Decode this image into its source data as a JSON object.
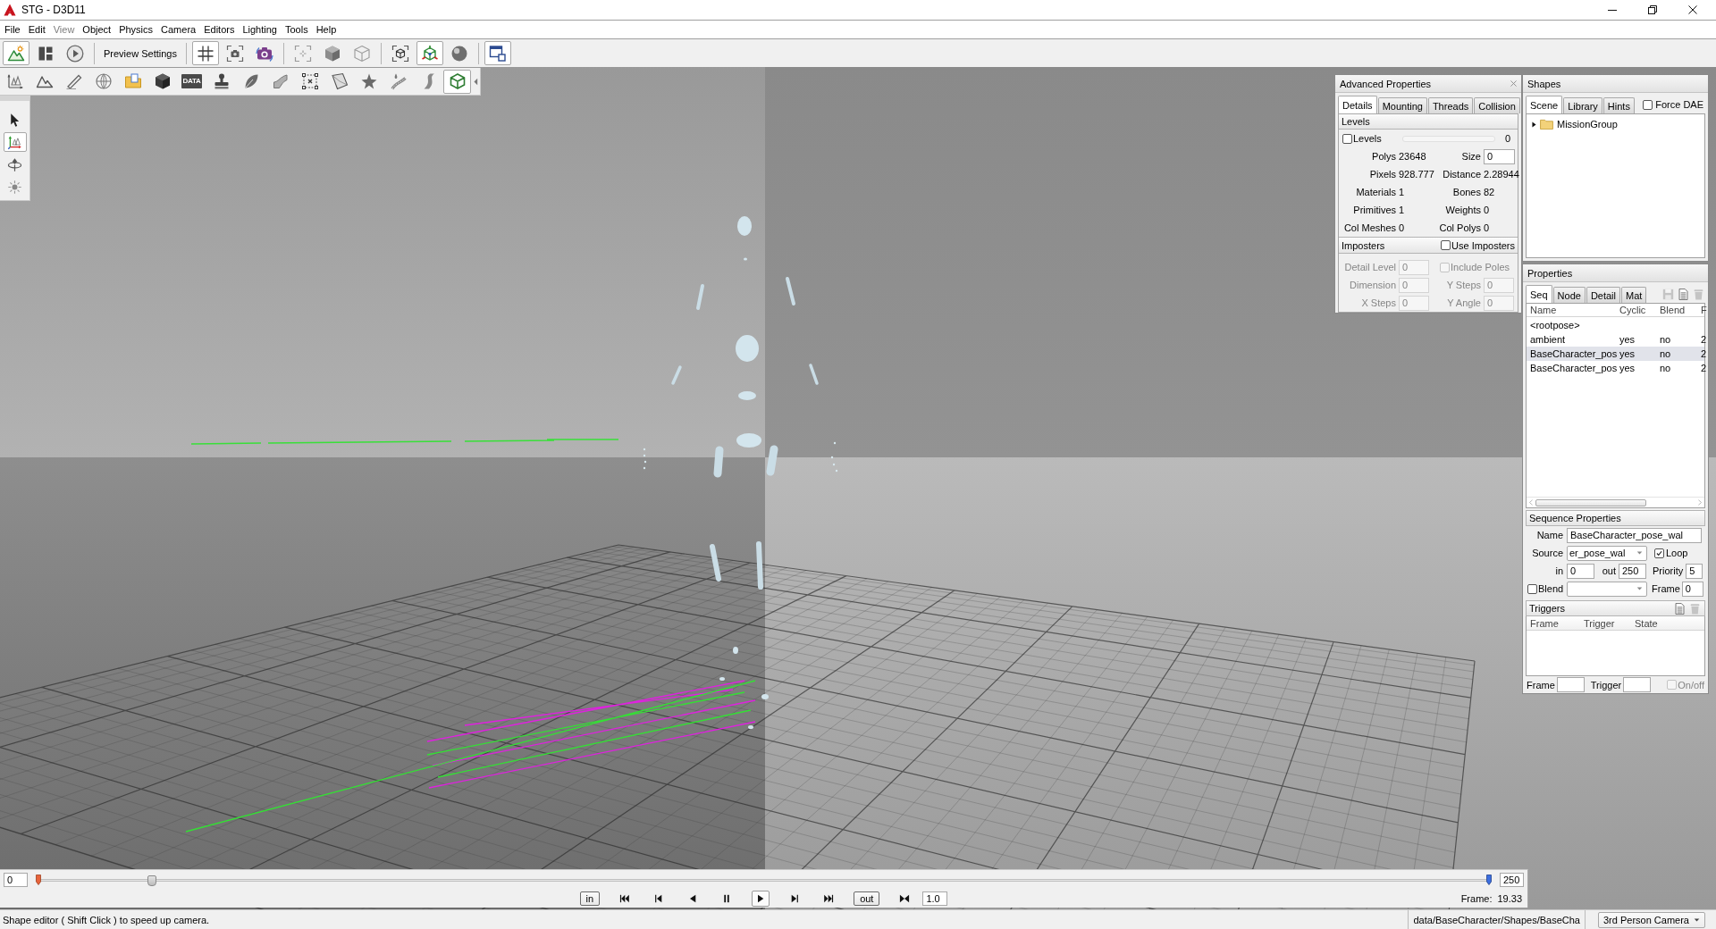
{
  "window": {
    "title": "STG - D3D11"
  },
  "menu": [
    {
      "label": "File",
      "disabled": false
    },
    {
      "label": "Edit",
      "disabled": false
    },
    {
      "label": "View",
      "disabled": true
    },
    {
      "label": "Object",
      "disabled": false
    },
    {
      "label": "Physics",
      "disabled": false
    },
    {
      "label": "Camera",
      "disabled": false
    },
    {
      "label": "Editors",
      "disabled": false
    },
    {
      "label": "Lighting",
      "disabled": false
    },
    {
      "label": "Tools",
      "disabled": false
    },
    {
      "label": "Help",
      "disabled": false
    }
  ],
  "toolbar": {
    "groups": [
      {
        "buttons": [
          {
            "kind": "icon",
            "selected": true
          },
          {
            "kind": "icon",
            "selected": false
          },
          {
            "kind": "icon",
            "selected": false
          }
        ]
      },
      {
        "buttons": [
          {
            "kind": "text",
            "label": "Preview Settings",
            "selected": false
          }
        ]
      },
      {
        "buttons": [
          {
            "kind": "icon",
            "selected": true
          },
          {
            "kind": "icon",
            "selected": false
          },
          {
            "kind": "icon",
            "selected": false
          }
        ]
      },
      {
        "buttons": [
          {
            "kind": "icon",
            "selected": false
          },
          {
            "kind": "icon",
            "selected": false
          },
          {
            "kind": "icon",
            "selected": false
          }
        ]
      },
      {
        "buttons": [
          {
            "kind": "icon",
            "selected": false
          },
          {
            "kind": "icon",
            "selected": true
          },
          {
            "kind": "icon",
            "selected": false
          }
        ]
      },
      {
        "buttons": [
          {
            "kind": "icon",
            "selected": true
          }
        ]
      }
    ]
  },
  "object_toolbar": {
    "buttons": [
      {
        "kind": "icon",
        "selected": false
      },
      {
        "kind": "icon",
        "selected": false
      },
      {
        "kind": "icon",
        "selected": false
      },
      {
        "kind": "icon",
        "selected": false
      },
      {
        "kind": "icon",
        "selected": false
      },
      {
        "kind": "icon",
        "selected": false
      },
      {
        "kind": "tile",
        "label": "DATA",
        "selected": false
      },
      {
        "kind": "icon",
        "selected": false
      },
      {
        "kind": "icon",
        "selected": false
      },
      {
        "kind": "icon",
        "selected": false
      },
      {
        "kind": "icon",
        "selected": false
      },
      {
        "kind": "icon",
        "selected": false
      },
      {
        "kind": "icon",
        "selected": false
      },
      {
        "kind": "icon",
        "selected": false
      },
      {
        "kind": "icon",
        "selected": false
      },
      {
        "kind": "icon",
        "selected": true
      }
    ]
  },
  "tool_palette": [
    {
      "selected": false
    },
    {
      "selected": true
    },
    {
      "selected": false
    },
    {
      "selected": false
    }
  ],
  "advanced_properties": {
    "title": "Advanced Properties",
    "tabs": [
      {
        "label": "Details",
        "selected": true
      },
      {
        "label": "Mounting",
        "selected": false
      },
      {
        "label": "Threads",
        "selected": false
      },
      {
        "label": "Collision",
        "selected": false
      }
    ],
    "levels": {
      "header": "Levels",
      "label": "Levels",
      "checked": false,
      "reading": "0"
    },
    "stats": [
      {
        "label": "Polys",
        "value": "23648",
        "kind": "text"
      },
      {
        "label": "Size",
        "value": "0",
        "kind": "field"
      },
      {
        "label": "Pixels",
        "value": "928.777",
        "kind": "text"
      },
      {
        "label": "Distance",
        "value": "2.28944",
        "kind": "text"
      },
      {
        "label": "Materials",
        "value": "1",
        "kind": "text"
      },
      {
        "label": "Bones",
        "value": "82",
        "kind": "text"
      },
      {
        "label": "Primitives",
        "value": "1",
        "kind": "text"
      },
      {
        "label": "Weights",
        "value": "0",
        "kind": "text"
      },
      {
        "label": "Col Meshes",
        "value": "0",
        "kind": "text"
      },
      {
        "label": "Col Polys",
        "value": "0",
        "kind": "text"
      }
    ],
    "imposters": {
      "header": "Imposters",
      "use_label": "Use Imposters",
      "use_checked": false,
      "disabled": true,
      "fields": [
        {
          "kind": "field",
          "label": "Detail Level",
          "value": "0"
        },
        {
          "kind": "checkbox",
          "label": "Include Poles",
          "checked": false
        },
        {
          "kind": "field",
          "label": "Dimension",
          "value": "0"
        },
        {
          "kind": "field",
          "label": "Y Steps",
          "value": "0"
        },
        {
          "kind": "field",
          "label": "X Steps",
          "value": "0"
        },
        {
          "kind": "field",
          "label": "Y Angle",
          "value": "0"
        }
      ]
    }
  },
  "shapes": {
    "title": "Shapes",
    "tabs": [
      {
        "label": "Scene",
        "selected": true
      },
      {
        "label": "Library",
        "selected": false
      },
      {
        "label": "Hints",
        "selected": false
      }
    ],
    "force_dae": {
      "label": "Force DAE",
      "checked": false
    },
    "tree": [
      {
        "label": "MissionGroup",
        "expanded": false
      }
    ]
  },
  "properties": {
    "title": "Properties",
    "tabs": [
      {
        "label": "Seq",
        "selected": true
      },
      {
        "label": "Node",
        "selected": false
      },
      {
        "label": "Detail",
        "selected": false
      },
      {
        "label": "Mat",
        "selected": false
      }
    ],
    "actions": [
      {
        "disabled": true
      },
      {
        "disabled": false
      },
      {
        "disabled": true
      }
    ],
    "columns": [
      "Name",
      "Cyclic",
      "Blend",
      "F"
    ],
    "rows": [
      {
        "cells": [
          "<rootpose>"
        ],
        "selected": false
      },
      {
        "cells": [
          "ambient",
          "yes",
          "no",
          "2"
        ],
        "selected": false
      },
      {
        "cells": [
          "BaseCharacter_pos",
          "yes",
          "no",
          "2"
        ],
        "selected": true
      },
      {
        "cells": [
          "BaseCharacter_pos",
          "yes",
          "no",
          "2"
        ],
        "selected": false
      }
    ]
  },
  "sequence_properties": {
    "header": "Sequence Properties",
    "name": {
      "label": "Name",
      "value": "BaseCharacter_pose_wal"
    },
    "source": {
      "label": "Source",
      "value": "er_pose_wal"
    },
    "loop": {
      "label": "Loop",
      "checked": true
    },
    "in": {
      "label": "in",
      "value": "0"
    },
    "out": {
      "label": "out",
      "value": "250"
    },
    "priority": {
      "label": "Priority",
      "value": "5"
    },
    "blend": {
      "label": "Blend",
      "checked": false
    },
    "frame": {
      "label": "Frame",
      "value": "0"
    }
  },
  "triggers": {
    "header": "Triggers",
    "actions": [
      {
        "disabled": false
      },
      {
        "disabled": true
      }
    ],
    "columns": [
      "Frame",
      "Trigger",
      "State"
    ],
    "frame": {
      "label": "Frame"
    },
    "trigger": {
      "label": "Trigger"
    },
    "onoff": {
      "label": "On/off",
      "checked": false,
      "disabled": true
    }
  },
  "timeline": {
    "start": "0",
    "end": "250",
    "level": 0.08,
    "buttons": [
      {
        "kind": "text",
        "label": "in",
        "selected": false
      },
      {
        "kind": "icon",
        "selected": false
      },
      {
        "kind": "icon",
        "selected": false
      },
      {
        "kind": "icon",
        "selected": false
      },
      {
        "kind": "icon",
        "selected": false
      },
      {
        "kind": "icon",
        "selected": true
      },
      {
        "kind": "icon",
        "selected": false
      },
      {
        "kind": "icon",
        "selected": false
      },
      {
        "kind": "text",
        "label": "out",
        "selected": false
      },
      {
        "kind": "icon",
        "selected": false
      }
    ],
    "speed": "1.0",
    "frame_label": "Frame:",
    "frame_value": "19.33"
  },
  "status_bar": {
    "message": "Shape editor ( Shift Click ) to speed up camera.",
    "path": "data/BaseCharacter/Shapes/BaseCha",
    "camera": "3rd Person Camera"
  }
}
